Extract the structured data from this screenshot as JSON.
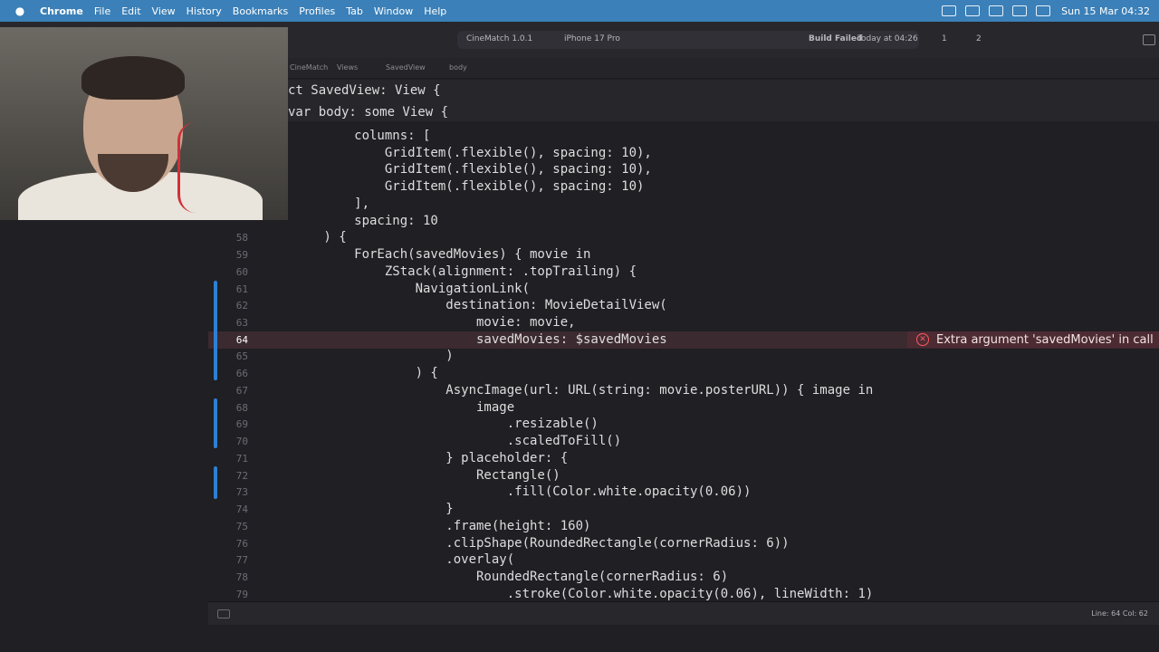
{
  "menubar": {
    "items": [
      "Chrome",
      "File",
      "Edit",
      "View",
      "History",
      "Bookmarks",
      "Profiles",
      "Tab",
      "Window",
      "Help"
    ],
    "datetime": "Sun 15 Mar  04:32"
  },
  "toolbar": {
    "scheme": "CineMatch 1.0.1",
    "device": "iPhone 17 Pro",
    "build_status": "Build Failed",
    "build_time": "Today at 04:26",
    "error_count": "1",
    "warning_count": "2"
  },
  "jumpbar": {
    "crumbs": [
      "CineMatch",
      "Views",
      "SavedView",
      "body"
    ]
  },
  "sticky": {
    "line1": "ct SavedView: View {",
    "line2": "var body: some View {"
  },
  "editor": {
    "lines": [
      {
        "num": "",
        "text": "            columns: ["
      },
      {
        "num": "",
        "text": "                GridItem(.flexible(), spacing: 10),"
      },
      {
        "num": "",
        "text": "                GridItem(.flexible(), spacing: 10),"
      },
      {
        "num": "",
        "text": "                GridItem(.flexible(), spacing: 10)"
      },
      {
        "num": "",
        "text": "            ],"
      },
      {
        "num": "",
        "text": "            spacing: 10"
      },
      {
        "num": "58",
        "text": "        ) {"
      },
      {
        "num": "59",
        "text": "            ForEach(savedMovies) { movie in"
      },
      {
        "num": "60",
        "text": "                ZStack(alignment: .topTrailing) {"
      },
      {
        "num": "61",
        "text": "                    NavigationLink("
      },
      {
        "num": "62",
        "text": "                        destination: MovieDetailView("
      },
      {
        "num": "63",
        "text": "                            movie: movie,"
      },
      {
        "num": "64",
        "text": "                            savedMovies: $savedMovies"
      },
      {
        "num": "65",
        "text": "                        )"
      },
      {
        "num": "66",
        "text": "                    ) {"
      },
      {
        "num": "67",
        "text": "                        AsyncImage(url: URL(string: movie.posterURL)) { image in"
      },
      {
        "num": "68",
        "text": "                            image"
      },
      {
        "num": "69",
        "text": "                                .resizable()"
      },
      {
        "num": "70",
        "text": "                                .scaledToFill()"
      },
      {
        "num": "71",
        "text": "                        } placeholder: {"
      },
      {
        "num": "72",
        "text": "                            Rectangle()"
      },
      {
        "num": "73",
        "text": "                                .fill(Color.white.opacity(0.06))"
      },
      {
        "num": "74",
        "text": "                        }"
      },
      {
        "num": "75",
        "text": "                        .frame(height: 160)"
      },
      {
        "num": "76",
        "text": "                        .clipShape(RoundedRectangle(cornerRadius: 6))"
      },
      {
        "num": "77",
        "text": "                        .overlay("
      },
      {
        "num": "78",
        "text": "                            RoundedRectangle(cornerRadius: 6)"
      },
      {
        "num": "79",
        "text": "                                .stroke(Color.white.opacity(0.06), lineWidth: 1)"
      }
    ],
    "error_message": "Extra argument 'savedMovies' in call"
  },
  "statusbar": {
    "cursor": "Line: 64  Col: 62"
  },
  "colors": {
    "menubar": "#3b80b8",
    "editor_bg": "#1f1f24",
    "keyword": "#fc5fa3",
    "type": "#d0a8ff",
    "number": "#d0bf69",
    "error": "#ff5a5f"
  }
}
